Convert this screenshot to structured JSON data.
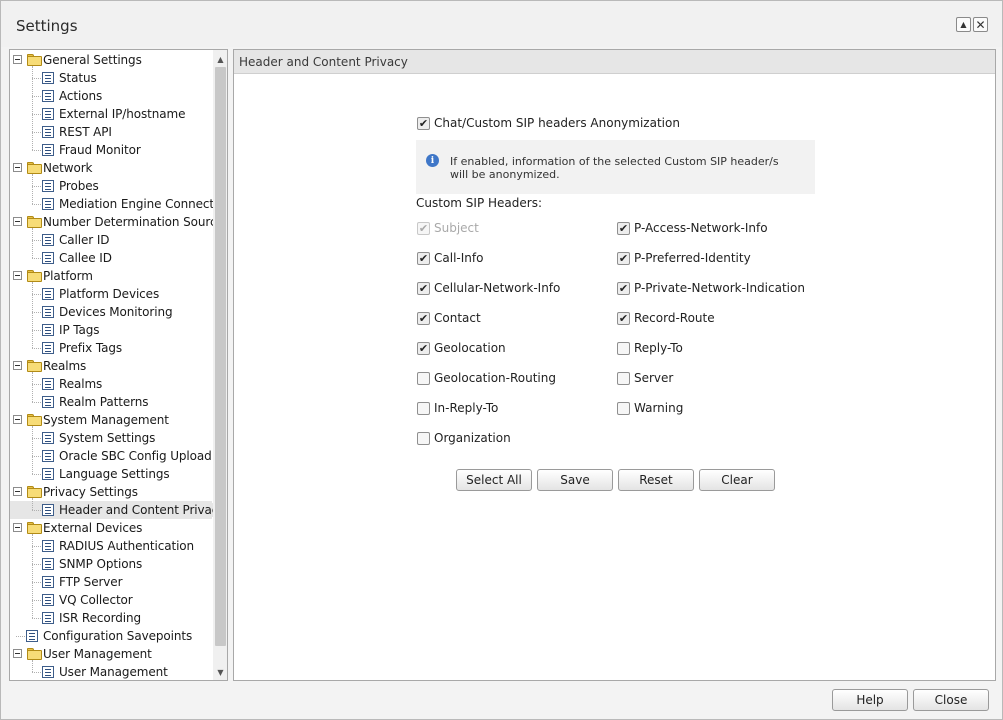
{
  "window": {
    "title": "Settings"
  },
  "tree": [
    {
      "label": "General Settings",
      "type": "folder",
      "level": 0
    },
    {
      "label": "Status",
      "type": "item",
      "level": 1
    },
    {
      "label": "Actions",
      "type": "item",
      "level": 1
    },
    {
      "label": "External IP/hostname",
      "type": "item",
      "level": 1
    },
    {
      "label": "REST API",
      "type": "item",
      "level": 1
    },
    {
      "label": "Fraud Monitor",
      "type": "item",
      "level": 1
    },
    {
      "label": "Network",
      "type": "folder",
      "level": 0
    },
    {
      "label": "Probes",
      "type": "item",
      "level": 1
    },
    {
      "label": "Mediation Engine Connector",
      "type": "item",
      "level": 1
    },
    {
      "label": "Number Determination Sources",
      "type": "folder",
      "level": 0
    },
    {
      "label": "Caller ID",
      "type": "item",
      "level": 1
    },
    {
      "label": "Callee ID",
      "type": "item",
      "level": 1
    },
    {
      "label": "Platform",
      "type": "folder",
      "level": 0
    },
    {
      "label": "Platform Devices",
      "type": "item",
      "level": 1
    },
    {
      "label": "Devices Monitoring",
      "type": "item",
      "level": 1
    },
    {
      "label": "IP Tags",
      "type": "item",
      "level": 1
    },
    {
      "label": "Prefix Tags",
      "type": "item",
      "level": 1
    },
    {
      "label": "Realms",
      "type": "folder",
      "level": 0
    },
    {
      "label": "Realms",
      "type": "item",
      "level": 1
    },
    {
      "label": "Realm Patterns",
      "type": "item",
      "level": 1
    },
    {
      "label": "System Management",
      "type": "folder",
      "level": 0
    },
    {
      "label": "System Settings",
      "type": "item",
      "level": 1
    },
    {
      "label": "Oracle SBC Config Upload",
      "type": "item",
      "level": 1
    },
    {
      "label": "Language Settings",
      "type": "item",
      "level": 1
    },
    {
      "label": "Privacy Settings",
      "type": "folder",
      "level": 0
    },
    {
      "label": "Header and Content Privacy",
      "type": "item",
      "level": 1,
      "selected": true
    },
    {
      "label": "External Devices",
      "type": "folder",
      "level": 0
    },
    {
      "label": "RADIUS Authentication",
      "type": "item",
      "level": 1
    },
    {
      "label": "SNMP Options",
      "type": "item",
      "level": 1
    },
    {
      "label": "FTP Server",
      "type": "item",
      "level": 1
    },
    {
      "label": "VQ Collector",
      "type": "item",
      "level": 1
    },
    {
      "label": "ISR Recording",
      "type": "item",
      "level": 1
    },
    {
      "label": "Configuration Savepoints",
      "type": "item",
      "level": 0
    },
    {
      "label": "User Management",
      "type": "folder",
      "level": 0
    },
    {
      "label": "User Management",
      "type": "item",
      "level": 1
    }
  ],
  "content": {
    "header": "Header and Content Privacy",
    "anonymization": {
      "label": "Chat/Custom SIP headers Anonymization",
      "checked": true
    },
    "info_text": "If enabled, information of the selected Custom SIP header/s will be anonymized.",
    "section_label": "Custom SIP Headers:",
    "left_headers": [
      {
        "label": "Subject",
        "checked": true,
        "disabled": true
      },
      {
        "label": "Call-Info",
        "checked": true
      },
      {
        "label": "Cellular-Network-Info",
        "checked": true
      },
      {
        "label": "Contact",
        "checked": true
      },
      {
        "label": "Geolocation",
        "checked": true
      },
      {
        "label": "Geolocation-Routing",
        "checked": false
      },
      {
        "label": "In-Reply-To",
        "checked": false
      },
      {
        "label": "Organization",
        "checked": false
      }
    ],
    "right_headers": [
      {
        "label": "P-Access-Network-Info",
        "checked": true
      },
      {
        "label": "P-Preferred-Identity",
        "checked": true
      },
      {
        "label": "P-Private-Network-Indication",
        "checked": true
      },
      {
        "label": "Record-Route",
        "checked": true
      },
      {
        "label": "Reply-To",
        "checked": false
      },
      {
        "label": "Server",
        "checked": false
      },
      {
        "label": "Warning",
        "checked": false
      }
    ],
    "buttons": {
      "select_all": "Select All",
      "save": "Save",
      "reset": "Reset",
      "clear": "Clear"
    }
  },
  "footer": {
    "help": "Help",
    "close": "Close"
  },
  "icons": {
    "check_glyph": "✔",
    "scroll_up": "▲",
    "scroll_down": "▼",
    "maximize": "▲",
    "close": "✕",
    "info": "i"
  }
}
